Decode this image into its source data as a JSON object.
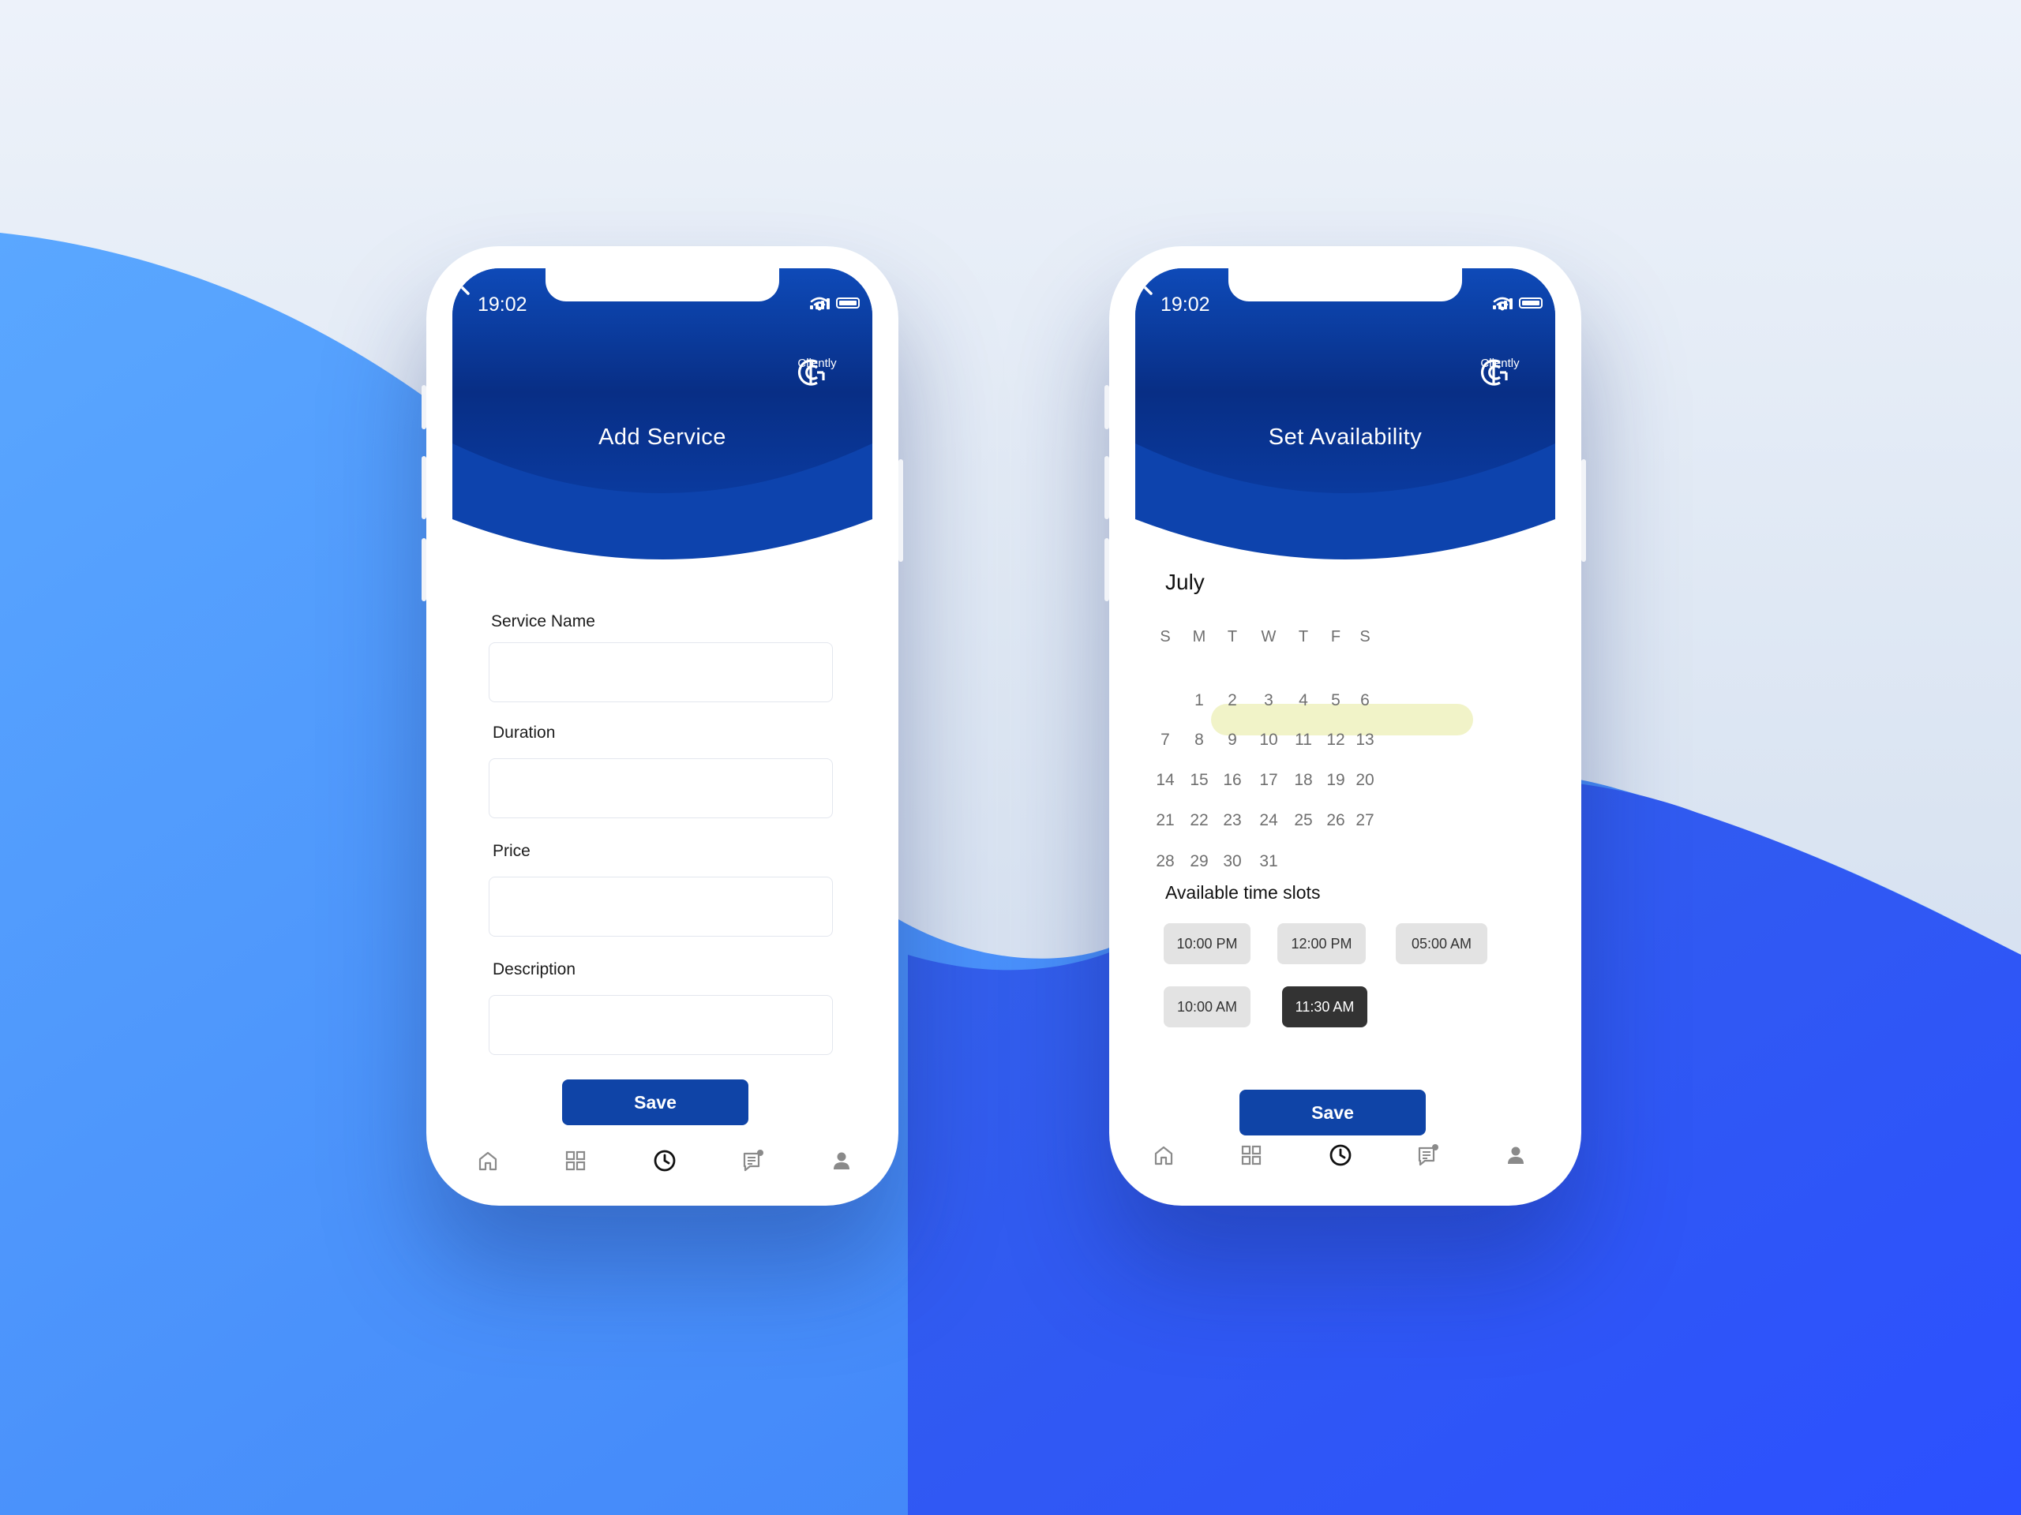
{
  "colors": {
    "primary": "#0f44a7",
    "header_dark": "#062a79",
    "highlight": "#f1f3c8",
    "selected_slot": "#333333"
  },
  "phone1": {
    "status_time": "19:02",
    "title": "Add Service",
    "logo_text": "Cliently",
    "fields": [
      {
        "label": "Service Name",
        "value": "",
        "placeholder": ""
      },
      {
        "label": "Duration",
        "value": "",
        "placeholder": ""
      },
      {
        "label": "Price",
        "value": "",
        "placeholder": ""
      },
      {
        "label": "Description",
        "value": "",
        "placeholder": ""
      }
    ],
    "save_label": "Save"
  },
  "phone2": {
    "status_time": "19:02",
    "title": "Set Availability",
    "logo_text": "Cliently",
    "month": "July",
    "weekdays": [
      "S",
      "M",
      "T",
      "W",
      "T",
      "F",
      "S"
    ],
    "days": [
      [
        "",
        "1",
        "2",
        "3",
        "4",
        "5",
        "6"
      ],
      [
        "7",
        "8",
        "9",
        "10",
        "11",
        "12",
        "13"
      ],
      [
        "14",
        "15",
        "16",
        "17",
        "18",
        "19",
        "20"
      ],
      [
        "21",
        "22",
        "23",
        "24",
        "25",
        "26",
        "27"
      ],
      [
        "28",
        "29",
        "30",
        "31",
        "",
        "",
        ""
      ]
    ],
    "highlighted_days": [
      "8",
      "9",
      "10",
      "11",
      "12"
    ],
    "slots_title": "Available time slots",
    "slots": [
      "10:00 PM",
      "12:00 PM",
      "05:00 AM",
      "10:00 AM",
      "11:30 AM"
    ],
    "selected_slot": "11:30 AM",
    "save_label": "Save"
  },
  "nav_icons": [
    "home-icon",
    "grid-icon",
    "clock-icon",
    "chat-icon",
    "profile-icon"
  ],
  "active_nav": "clock-icon"
}
